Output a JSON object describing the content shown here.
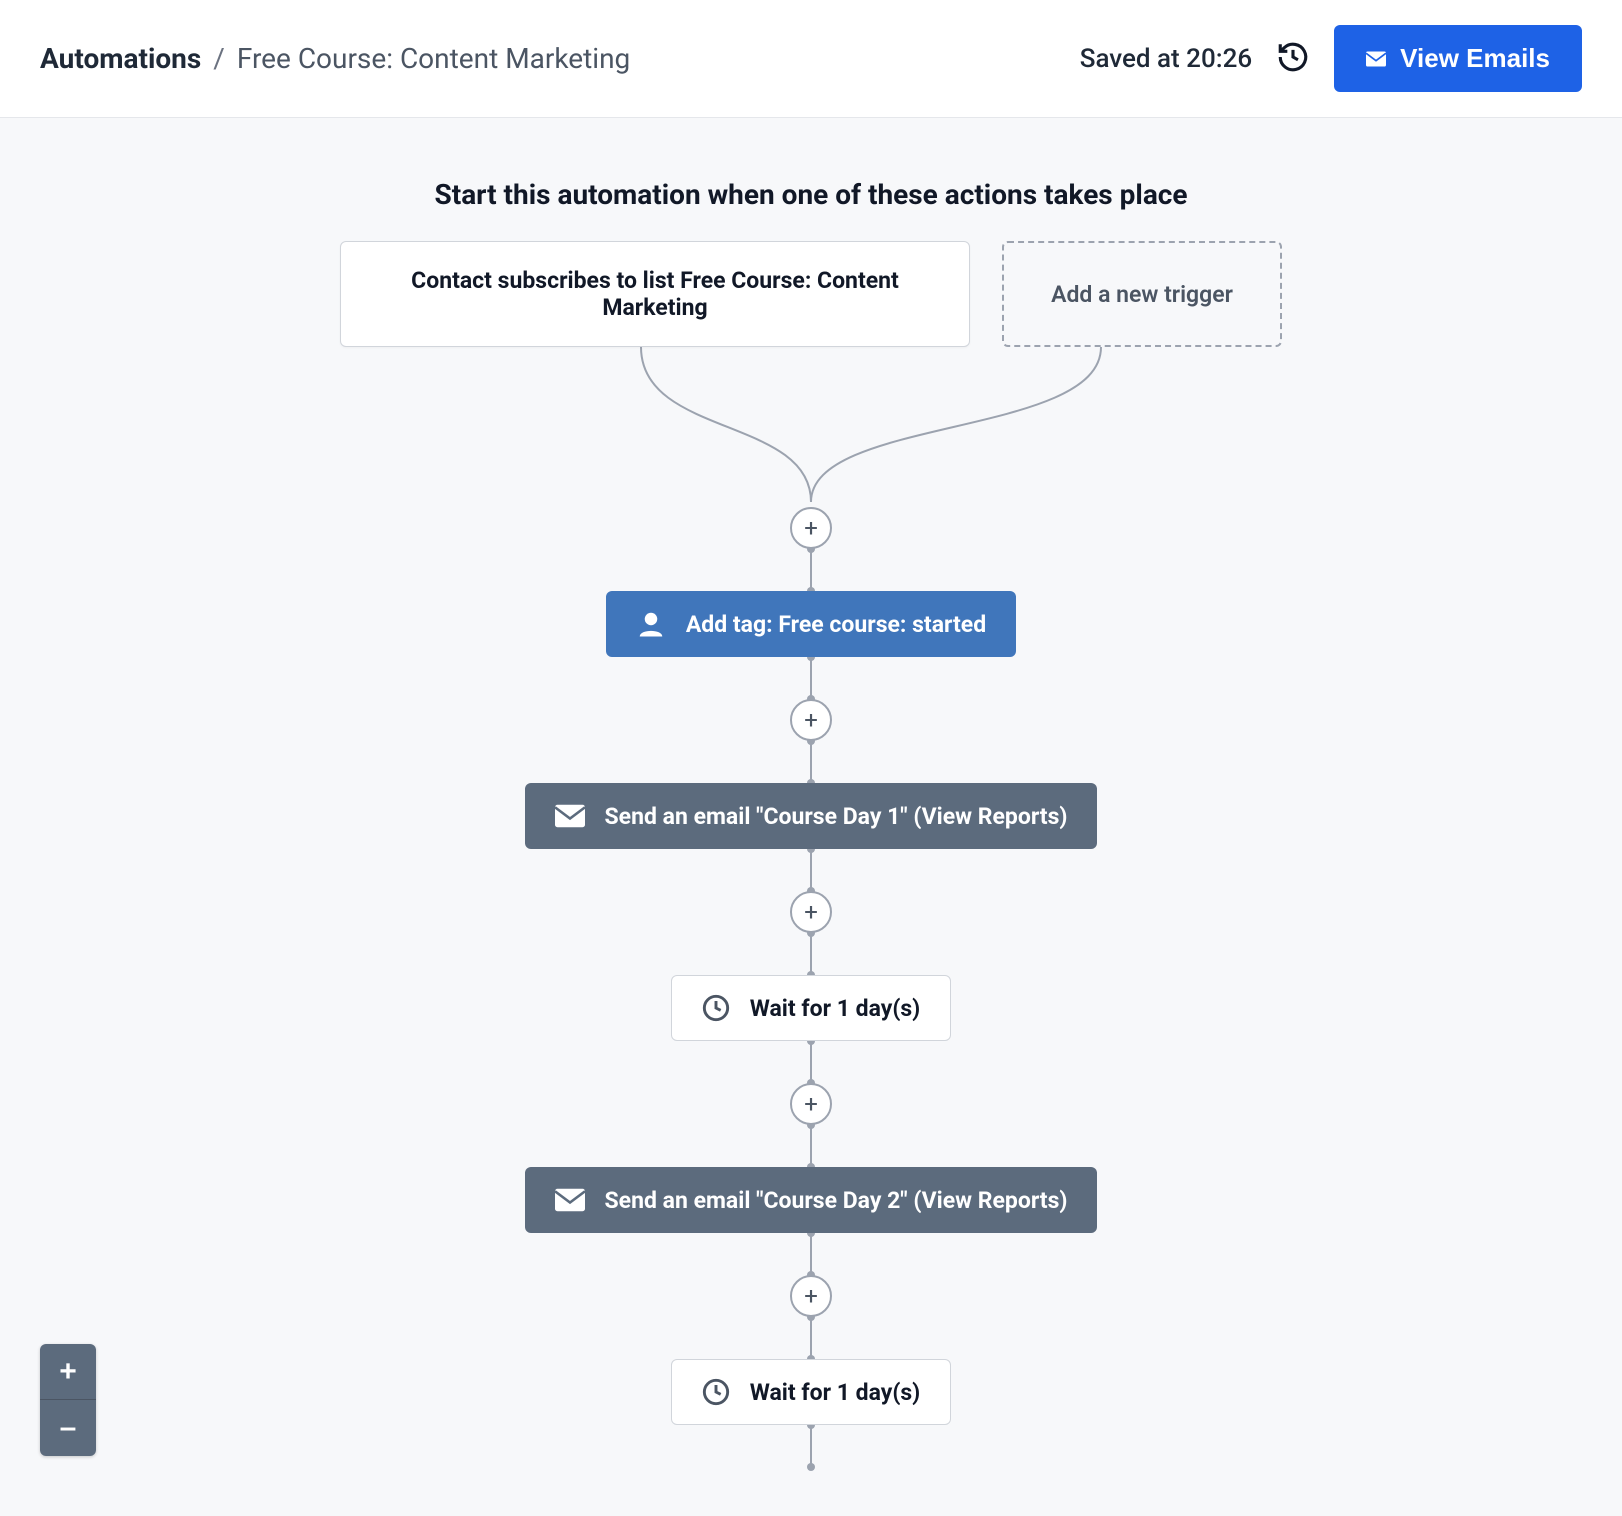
{
  "breadcrumb": {
    "root": "Automations",
    "current": "Free Course: Content Marketing"
  },
  "header": {
    "saved_text": "Saved at 20:26",
    "view_emails_label": "View Emails"
  },
  "start_heading": "Start this automation when one of these actions takes place",
  "triggers": {
    "trigger1": "Contact subscribes to list Free Course: Content Marketing",
    "add_trigger_label": "Add a new trigger"
  },
  "steps": {
    "tag1": "Add tag: Free course: started",
    "email1": "Send an email \"Course Day 1\" (View Reports)",
    "wait1": "Wait for 1 day(s)",
    "email2": "Send an email \"Course Day 2\" (View Reports)",
    "wait2": "Wait for 1 day(s)"
  },
  "zoom": {
    "in": "+",
    "out": "–"
  },
  "plus_label": "+"
}
